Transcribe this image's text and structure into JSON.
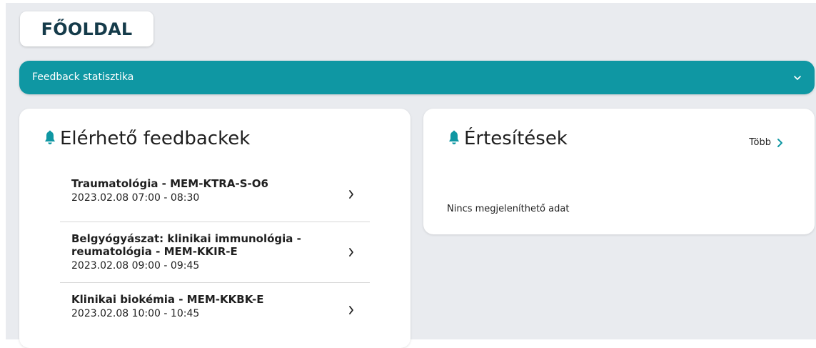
{
  "page": {
    "title": "FŐOLDAL"
  },
  "feedback_stats": {
    "label": "Feedback statisztika"
  },
  "available_feedbacks": {
    "title": "Elérhető feedbackek",
    "items": [
      {
        "title": "Traumatológia - MEM-KTRA-S-O6",
        "time": "2023.02.08 07:00 - 08:30"
      },
      {
        "title": "Belgyógyászat: klinikai immunológia - reumatológia - MEM-KKIR-E",
        "time": "2023.02.08 09:00 - 09:45"
      },
      {
        "title": "Klinikai biokémia - MEM-KKBK-E",
        "time": "2023.02.08 10:00 - 10:45"
      }
    ]
  },
  "notifications": {
    "title": "Értesítések",
    "more_label": "Több",
    "empty_text": "Nincs megjeleníthető adat"
  },
  "colors": {
    "accent": "#0f97a3",
    "title_text": "#153b4a",
    "background": "#e9ebef"
  },
  "icons": {
    "bell": "bell-icon",
    "chevron_down": "chevron-down-icon",
    "chevron_right": "chevron-right-icon"
  }
}
